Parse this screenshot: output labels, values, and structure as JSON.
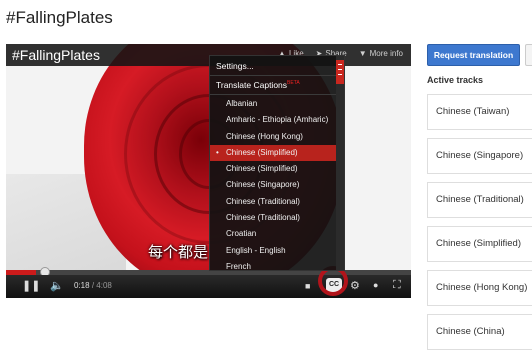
{
  "page": {
    "title": "#FallingPlates"
  },
  "player": {
    "video_title": "#FallingPlates",
    "top_actions": [
      {
        "label": "Like",
        "icon": "thumbs-up-icon"
      },
      {
        "label": "Share",
        "icon": "share-icon"
      },
      {
        "label": "More info",
        "icon": "info-icon"
      }
    ],
    "subtitle": "每个都是",
    "current_time": "0:18",
    "duration": "4:08",
    "progress_fraction": 0.073,
    "cc_label": "CC"
  },
  "cc_menu": {
    "settings": "Settings...",
    "translate": "Translate Captions",
    "beta": "BETA",
    "languages": [
      "Albanian",
      "Amharic - Ethiopia (Amharic)",
      "Chinese (Hong Kong)",
      "Chinese (Simplified)",
      "Chinese (Simplified)",
      "Chinese (Singapore)",
      "Chinese (Traditional)",
      "Chinese (Traditional)",
      "Croatian",
      "English - English",
      "French"
    ],
    "selected_index": 3,
    "selected_marker": "•"
  },
  "sidebar": {
    "request_button": "Request translation",
    "heading": "Active tracks",
    "tracks": [
      "Chinese (Taiwan)",
      "Chinese (Singapore)",
      "Chinese (Traditional)",
      "Chinese (Simplified)",
      "Chinese (Hong Kong)",
      "Chinese (China)"
    ]
  },
  "colors": {
    "accent_red": "#b8231d",
    "button_blue": "#3d78cf"
  }
}
